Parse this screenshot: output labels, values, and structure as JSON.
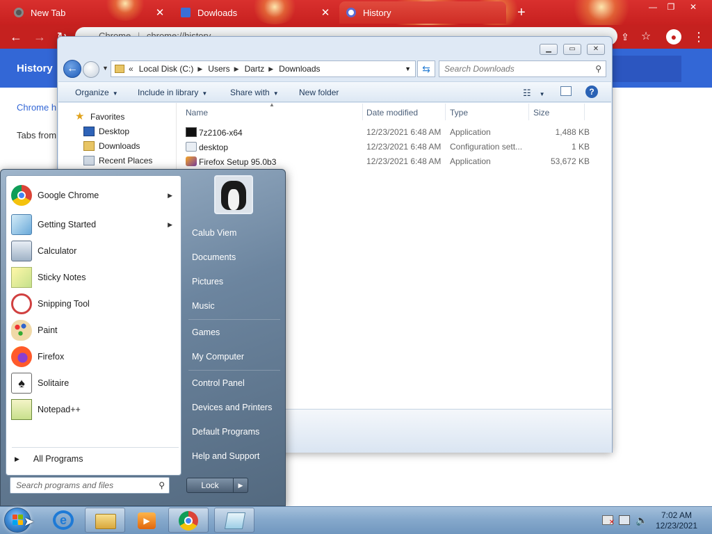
{
  "chrome": {
    "tabs": [
      {
        "title": "New Tab"
      },
      {
        "title": "Dowloads"
      },
      {
        "title": "History"
      }
    ],
    "new_tab_label": "+",
    "omnibox_prefix": "Chrome",
    "omnibox_url": "chrome://history",
    "page_title": "History",
    "sidebar_items": [
      "Chrome h",
      "Tabs from"
    ]
  },
  "explorer": {
    "breadcrumb": [
      "Local Disk (C:)",
      "Users",
      "Dartz",
      "Downloads"
    ],
    "breadcrumb_overflow": "«",
    "search_placeholder": "Search Downloads",
    "commands": {
      "organize": "Organize",
      "include_in_library": "Include in library",
      "share_with": "Share with",
      "new_folder": "New folder"
    },
    "nav": {
      "favorites": "Favorites",
      "desktop": "Desktop",
      "downloads": "Downloads",
      "recent_places": "Recent Places"
    },
    "columns": {
      "name": "Name",
      "date": "Date modified",
      "type": "Type",
      "size": "Size"
    },
    "files": [
      {
        "name": "7z2106-x64",
        "date": "12/23/2021 6:48 AM",
        "type": "Application",
        "size": "1,488 KB"
      },
      {
        "name": "desktop",
        "date": "12/23/2021 6:48 AM",
        "type": "Configuration sett...",
        "size": "1 KB"
      },
      {
        "name": "Firefox Setup 95.0b3",
        "date": "12/23/2021 6:48 AM",
        "type": "Application",
        "size": "53,672 KB"
      }
    ]
  },
  "start_menu": {
    "programs": [
      {
        "label": "Google Chrome",
        "icon": "chrome-icon",
        "submenu": true
      },
      {
        "label": "Getting Started",
        "icon": "getting-started-icon",
        "submenu": true
      },
      {
        "label": "Calculator",
        "icon": "calculator-icon"
      },
      {
        "label": "Sticky Notes",
        "icon": "sticky-notes-icon"
      },
      {
        "label": "Snipping Tool",
        "icon": "snipping-tool-icon"
      },
      {
        "label": "Paint",
        "icon": "paint-icon"
      },
      {
        "label": "Firefox",
        "icon": "firefox-icon"
      },
      {
        "label": "Solitaire",
        "icon": "solitaire-icon"
      },
      {
        "label": "Notepad++",
        "icon": "notepadpp-icon"
      }
    ],
    "all_programs": "All Programs",
    "search_placeholder": "Search programs and files",
    "right_links": [
      "Calub Viem",
      "Documents",
      "Pictures",
      "Music",
      "Games",
      "My Computer",
      "Control Panel",
      "Devices and Printers",
      "Default Programs",
      "Help and Support"
    ],
    "lock_label": "Lock"
  },
  "taskbar": {
    "pinned": [
      "internet-explorer-icon",
      "windows-explorer-icon",
      "media-player-icon",
      "chrome-icon",
      "notepad-icon"
    ],
    "time": "7:02 AM",
    "date": "12/23/2021"
  },
  "colors": {
    "chrome_theme": "#c5211f",
    "history_header": "#3367d6",
    "taskbar": "#86a9cc"
  }
}
